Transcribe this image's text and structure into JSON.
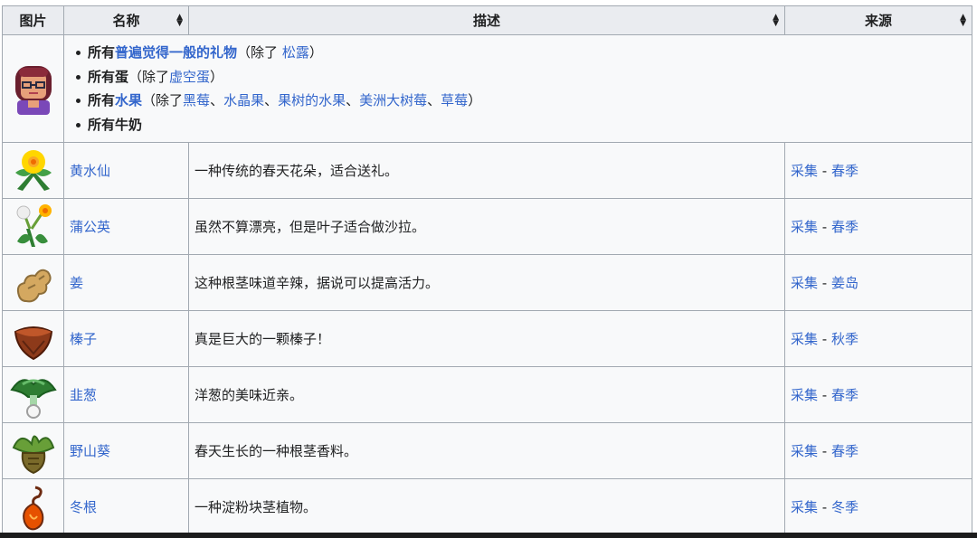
{
  "headers": {
    "image": "图片",
    "name": "名称",
    "desc": "描述",
    "source": "来源"
  },
  "intro": {
    "lines": [
      {
        "prefix": "所有",
        "link": "普遍觉得一般的礼物",
        "mid": "（除了 ",
        "ex": [
          "松露"
        ],
        "suffix": "）"
      },
      {
        "prefix": "所有蛋",
        "link": "",
        "mid": "（除了",
        "ex": [
          "虚空蛋"
        ],
        "suffix": "）"
      },
      {
        "prefix": "所有",
        "link": "水果",
        "mid": "（除了",
        "ex": [
          "黑莓",
          "水晶果",
          "果树的水果",
          "美洲大树莓",
          "草莓"
        ],
        "sep": "、",
        "suffix": "）"
      },
      {
        "prefix": "所有牛奶",
        "link": "",
        "mid": "",
        "ex": [],
        "suffix": ""
      }
    ]
  },
  "rows": [
    {
      "icon": "daffodil-icon",
      "name": "黄水仙",
      "desc": "一种传统的春天花朵，适合送礼。",
      "src_a": "采集",
      "src_b": "春季"
    },
    {
      "icon": "dandelion-icon",
      "name": "蒲公英",
      "desc": "虽然不算漂亮，但是叶子适合做沙拉。",
      "src_a": "采集",
      "src_b": "春季"
    },
    {
      "icon": "ginger-icon",
      "name": "姜",
      "desc": "这种根茎味道辛辣，据说可以提高活力。",
      "src_a": "采集",
      "src_b": "姜岛"
    },
    {
      "icon": "hazelnut-icon",
      "name": "榛子",
      "desc": "真是巨大的一颗榛子！",
      "src_a": "采集",
      "src_b": "秋季"
    },
    {
      "icon": "leek-icon",
      "name": "韭葱",
      "desc": "洋葱的美味近亲。",
      "src_a": "采集",
      "src_b": "春季"
    },
    {
      "icon": "wild-horseradish-icon",
      "name": "野山葵",
      "desc": "春天生长的一种根茎香料。",
      "src_a": "采集",
      "src_b": "春季"
    },
    {
      "icon": "winter-root-icon",
      "name": "冬根",
      "desc": "一种淀粉块茎植物。",
      "src_a": "采集",
      "src_b": "冬季"
    }
  ],
  "colors": {
    "link": "#3366cc",
    "header_bg": "#eaecf0",
    "border": "#a2a9b1"
  }
}
